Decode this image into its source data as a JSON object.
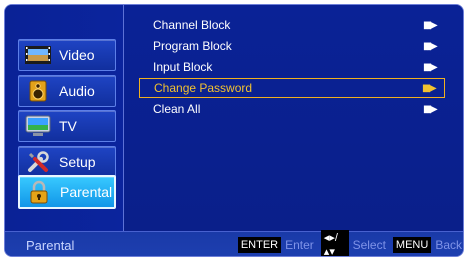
{
  "sidebar": {
    "items": [
      {
        "label": "Video",
        "icon": "film-icon",
        "active": false
      },
      {
        "label": "Audio",
        "icon": "speaker-icon",
        "active": false
      },
      {
        "label": "TV",
        "icon": "tv-icon",
        "active": false
      },
      {
        "label": "Setup",
        "icon": "tools-icon",
        "active": false
      },
      {
        "label": "Parental",
        "icon": "lock-icon",
        "active": true
      }
    ]
  },
  "menu": {
    "items": [
      {
        "label": "Channel Block",
        "selected": false
      },
      {
        "label": "Program Block",
        "selected": false
      },
      {
        "label": "Input Block",
        "selected": false
      },
      {
        "label": "Change Password",
        "selected": true
      },
      {
        "label": "Clean All",
        "selected": false
      }
    ]
  },
  "status": {
    "title": "Parental",
    "enter_key": "ENTER",
    "enter_hint": "Enter",
    "select_key": "◂▸/▴▾",
    "select_hint": "Select",
    "menu_key": "MENU",
    "back_hint": "Back"
  },
  "colors": {
    "background": "#0a1f8f",
    "highlight": "#f2c230",
    "active_tab": "#1fb0f5"
  }
}
